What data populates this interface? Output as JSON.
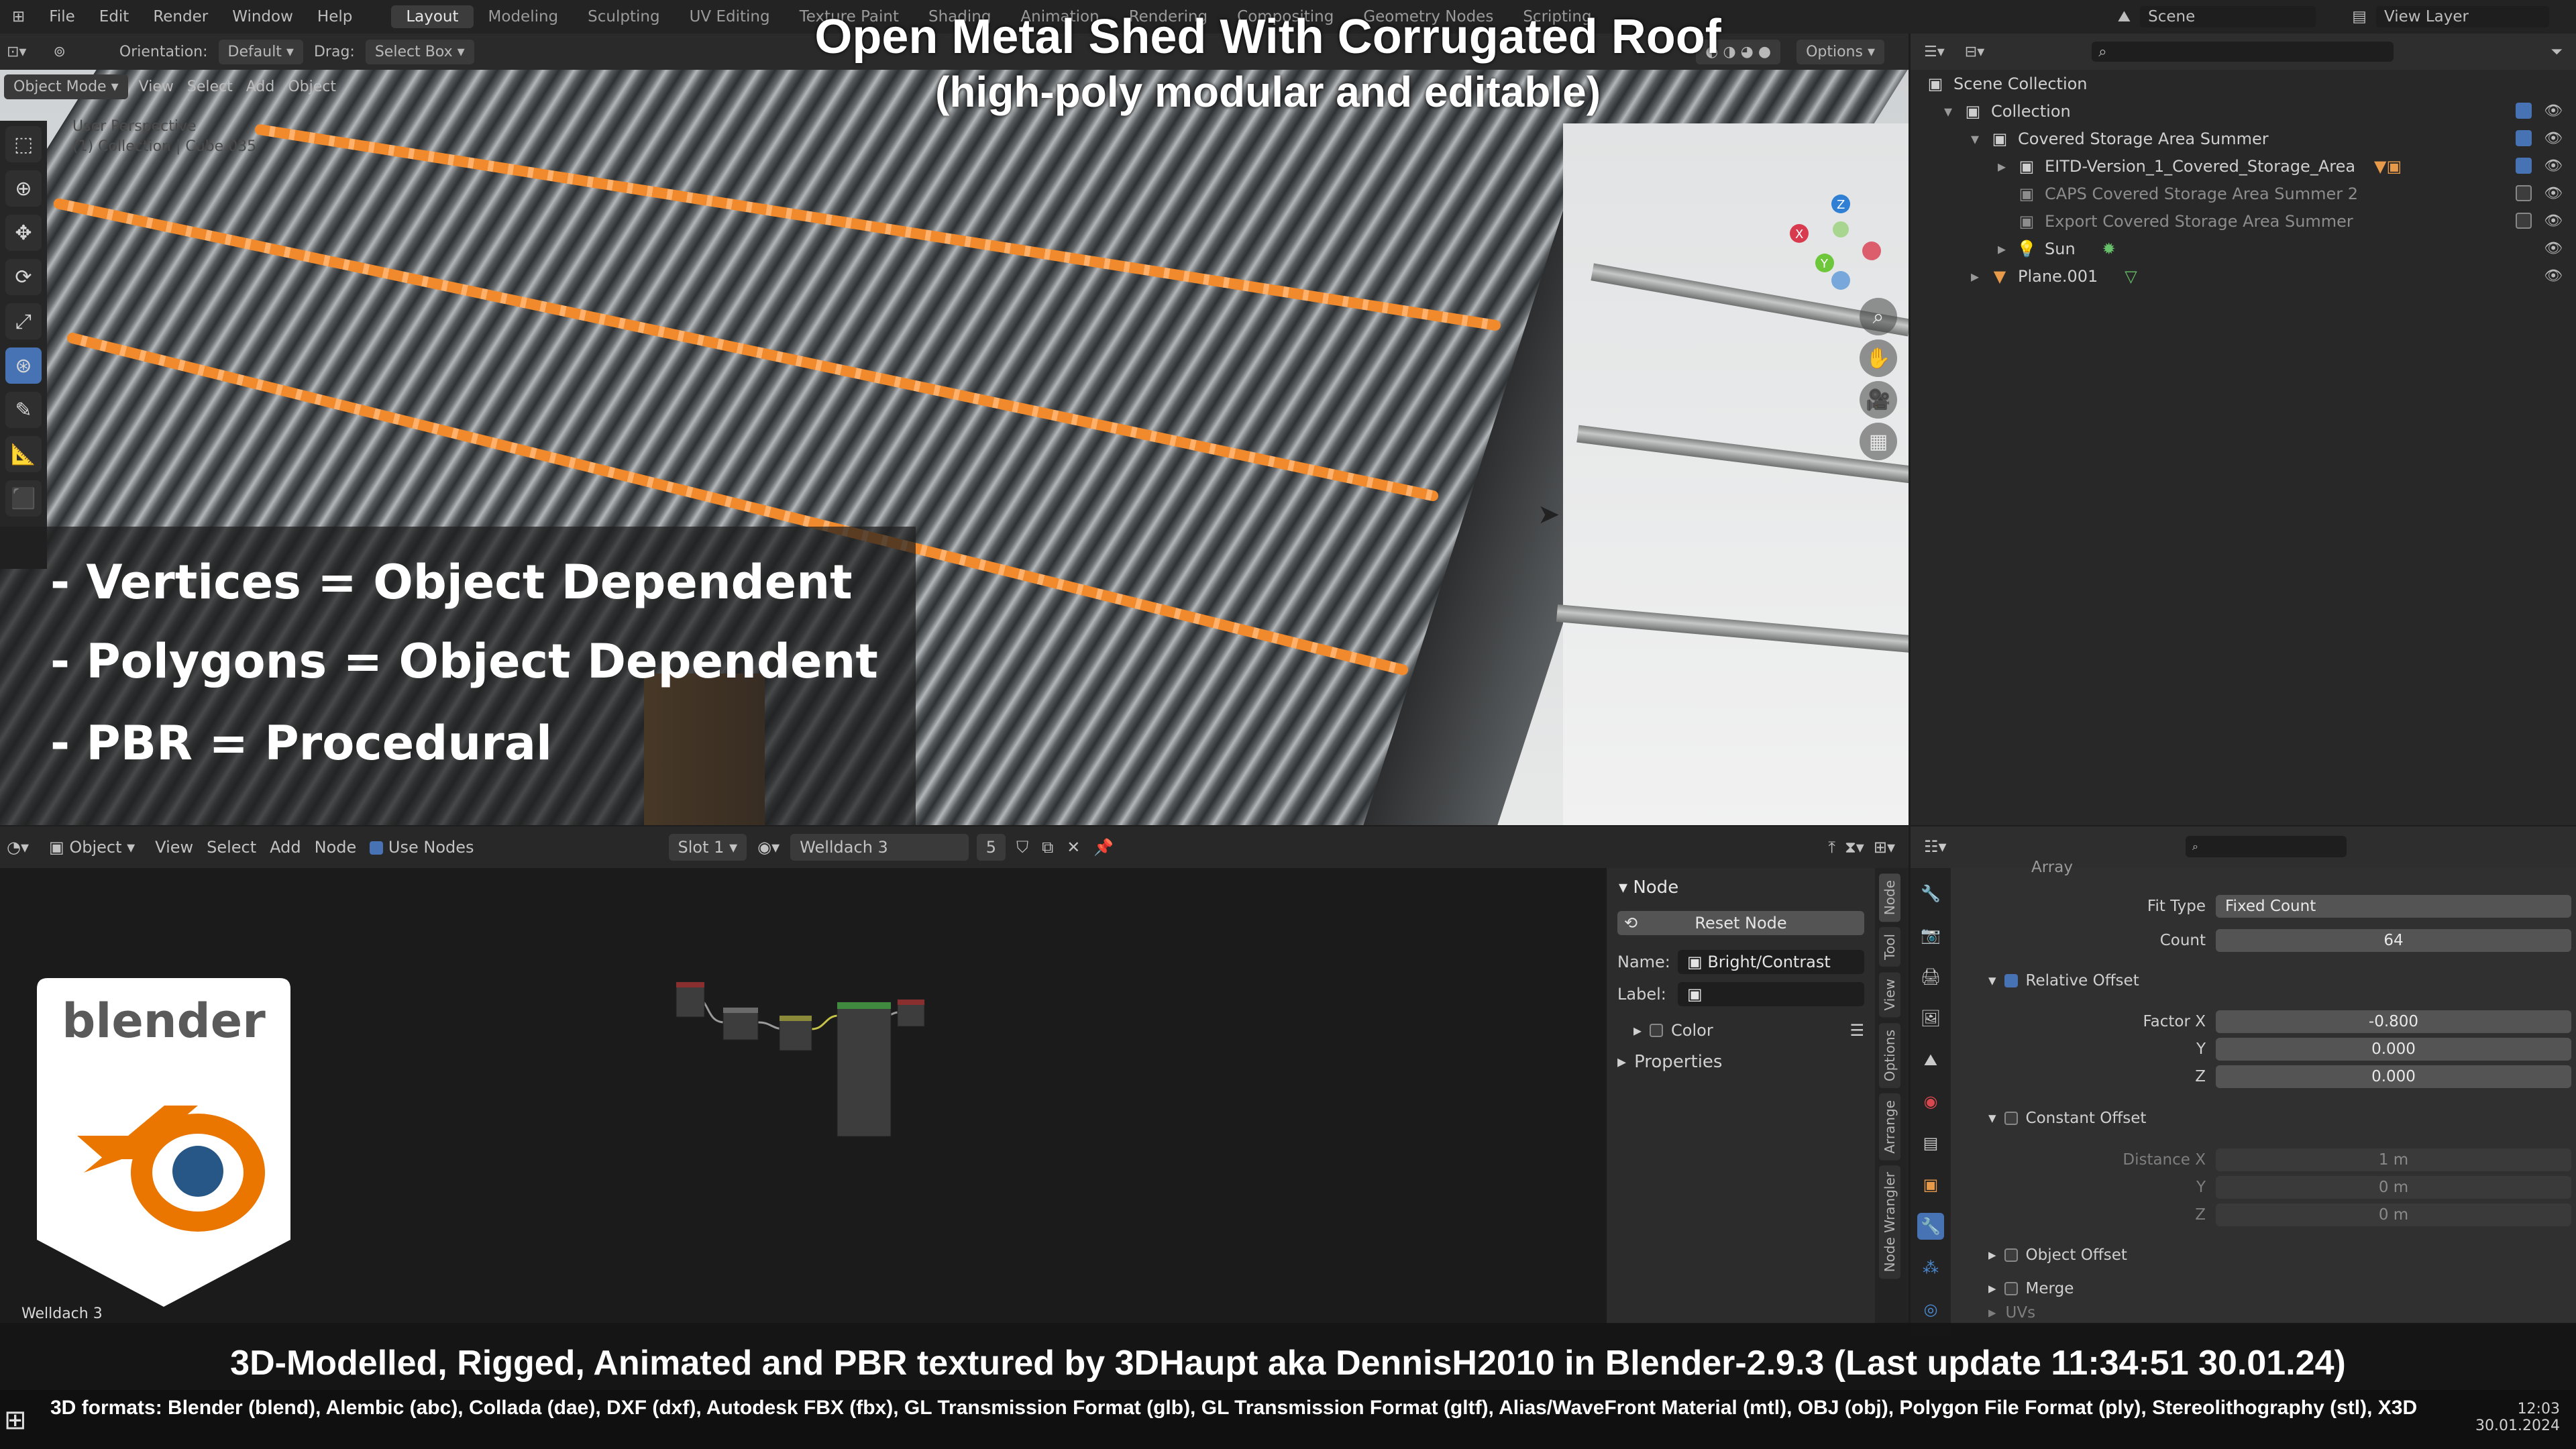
{
  "overlay": {
    "title": "Open Metal Shed With Corrugated Roof",
    "subtitle": "(high-poly modular and editable)",
    "spec_lines": [
      "- Vertices = Object Dependent",
      "- Polygons = Object Dependent",
      "- PBR =  Procedural"
    ],
    "credit": "3D-Modelled, Rigged, Animated and PBR textured by 3DHaupt aka DennisH2010 in Blender-2.9.3 (Last update 11:34:51  30.01.24)",
    "formats": "3D formats: Blender (blend), Alembic (abc), Collada (dae), DXF (dxf), Autodesk FBX (fbx), GL Transmission Format (glb), GL Transmission Format (gltf), Alias/WaveFront Material (mtl), OBJ (obj), Polygon File Format (ply), Stereolithography (stl), X3D",
    "logo_text": "blender"
  },
  "menu": {
    "items": [
      "File",
      "Edit",
      "Render",
      "Window",
      "Help"
    ],
    "workspaces": [
      "Layout",
      "Modeling",
      "Sculpting",
      "UV Editing",
      "Texture Paint",
      "Shading",
      "Animation",
      "Rendering",
      "Compositing",
      "Geometry Nodes",
      "Scripting"
    ],
    "active_workspace": "Layout",
    "scene": "Scene",
    "view_layer": "View Layer"
  },
  "viewport_header": {
    "orientation_label": "Orientation:",
    "orientation_value": "Default",
    "drag_label": "Drag:",
    "drag_value": "Select Box",
    "options": "Options",
    "mode": "Object Mode",
    "view": "View",
    "select": "Select",
    "add": "Add",
    "object": "Object",
    "perspective": "User Perspective",
    "collection_info": "(1) Collection | Cube.035"
  },
  "outliner": {
    "scene_collection": "Scene Collection",
    "rows": [
      {
        "label": "Collection",
        "indent": 1
      },
      {
        "label": "Covered Storage Area Summer",
        "indent": 2
      },
      {
        "label": "EITD-Version_1_Covered_Storage_Area",
        "indent": 3
      },
      {
        "label": "CAPS Covered Storage Area Summer 2",
        "indent": 3
      },
      {
        "label": "Export Covered Storage Area Summer",
        "indent": 3
      },
      {
        "label": "Sun",
        "indent": 3
      },
      {
        "label": "Plane.001",
        "indent": 2
      }
    ]
  },
  "node_header": {
    "type": "Object",
    "view": "View",
    "select": "Select",
    "add": "Add",
    "node": "Node",
    "use_nodes": "Use Nodes",
    "slot": "Slot 1",
    "material": "Welldach 3",
    "users": "5"
  },
  "node_panel": {
    "section": "Node",
    "reset": "Reset Node",
    "name_label": "Name:",
    "name_value": "Bright/Contrast",
    "label_label": "Label:",
    "color": "Color",
    "properties": "Properties",
    "tabs": [
      "Node",
      "Tool",
      "View",
      "Options",
      "Arrange",
      "Node Wrangler"
    ],
    "footer_name": "Welldach 3"
  },
  "properties": {
    "modifier": "Array",
    "fit_type_label": "Fit Type",
    "fit_type_value": "Fixed Count",
    "count_label": "Count",
    "count_value": "64",
    "relative_offset": "Relative Offset",
    "factor_x_label": "Factor X",
    "factor_x": "-0.800",
    "y_label": "Y",
    "factor_y": "0.000",
    "z_label": "Z",
    "factor_z": "0.000",
    "constant_offset": "Constant Offset",
    "distance_label": "Distance X",
    "distance_x": "1 m",
    "distance_y": "0 m",
    "distance_z": "0 m",
    "object_offset": "Object Offset",
    "merge": "Merge",
    "uvs": "UVs"
  },
  "status": {
    "time": "12:03",
    "date": "30.01.2024"
  },
  "colors": {
    "accent": "#4772b3",
    "blender_orange": "#ea7600",
    "blender_blue": "#265787",
    "seam_orange": "#f08a2c"
  }
}
